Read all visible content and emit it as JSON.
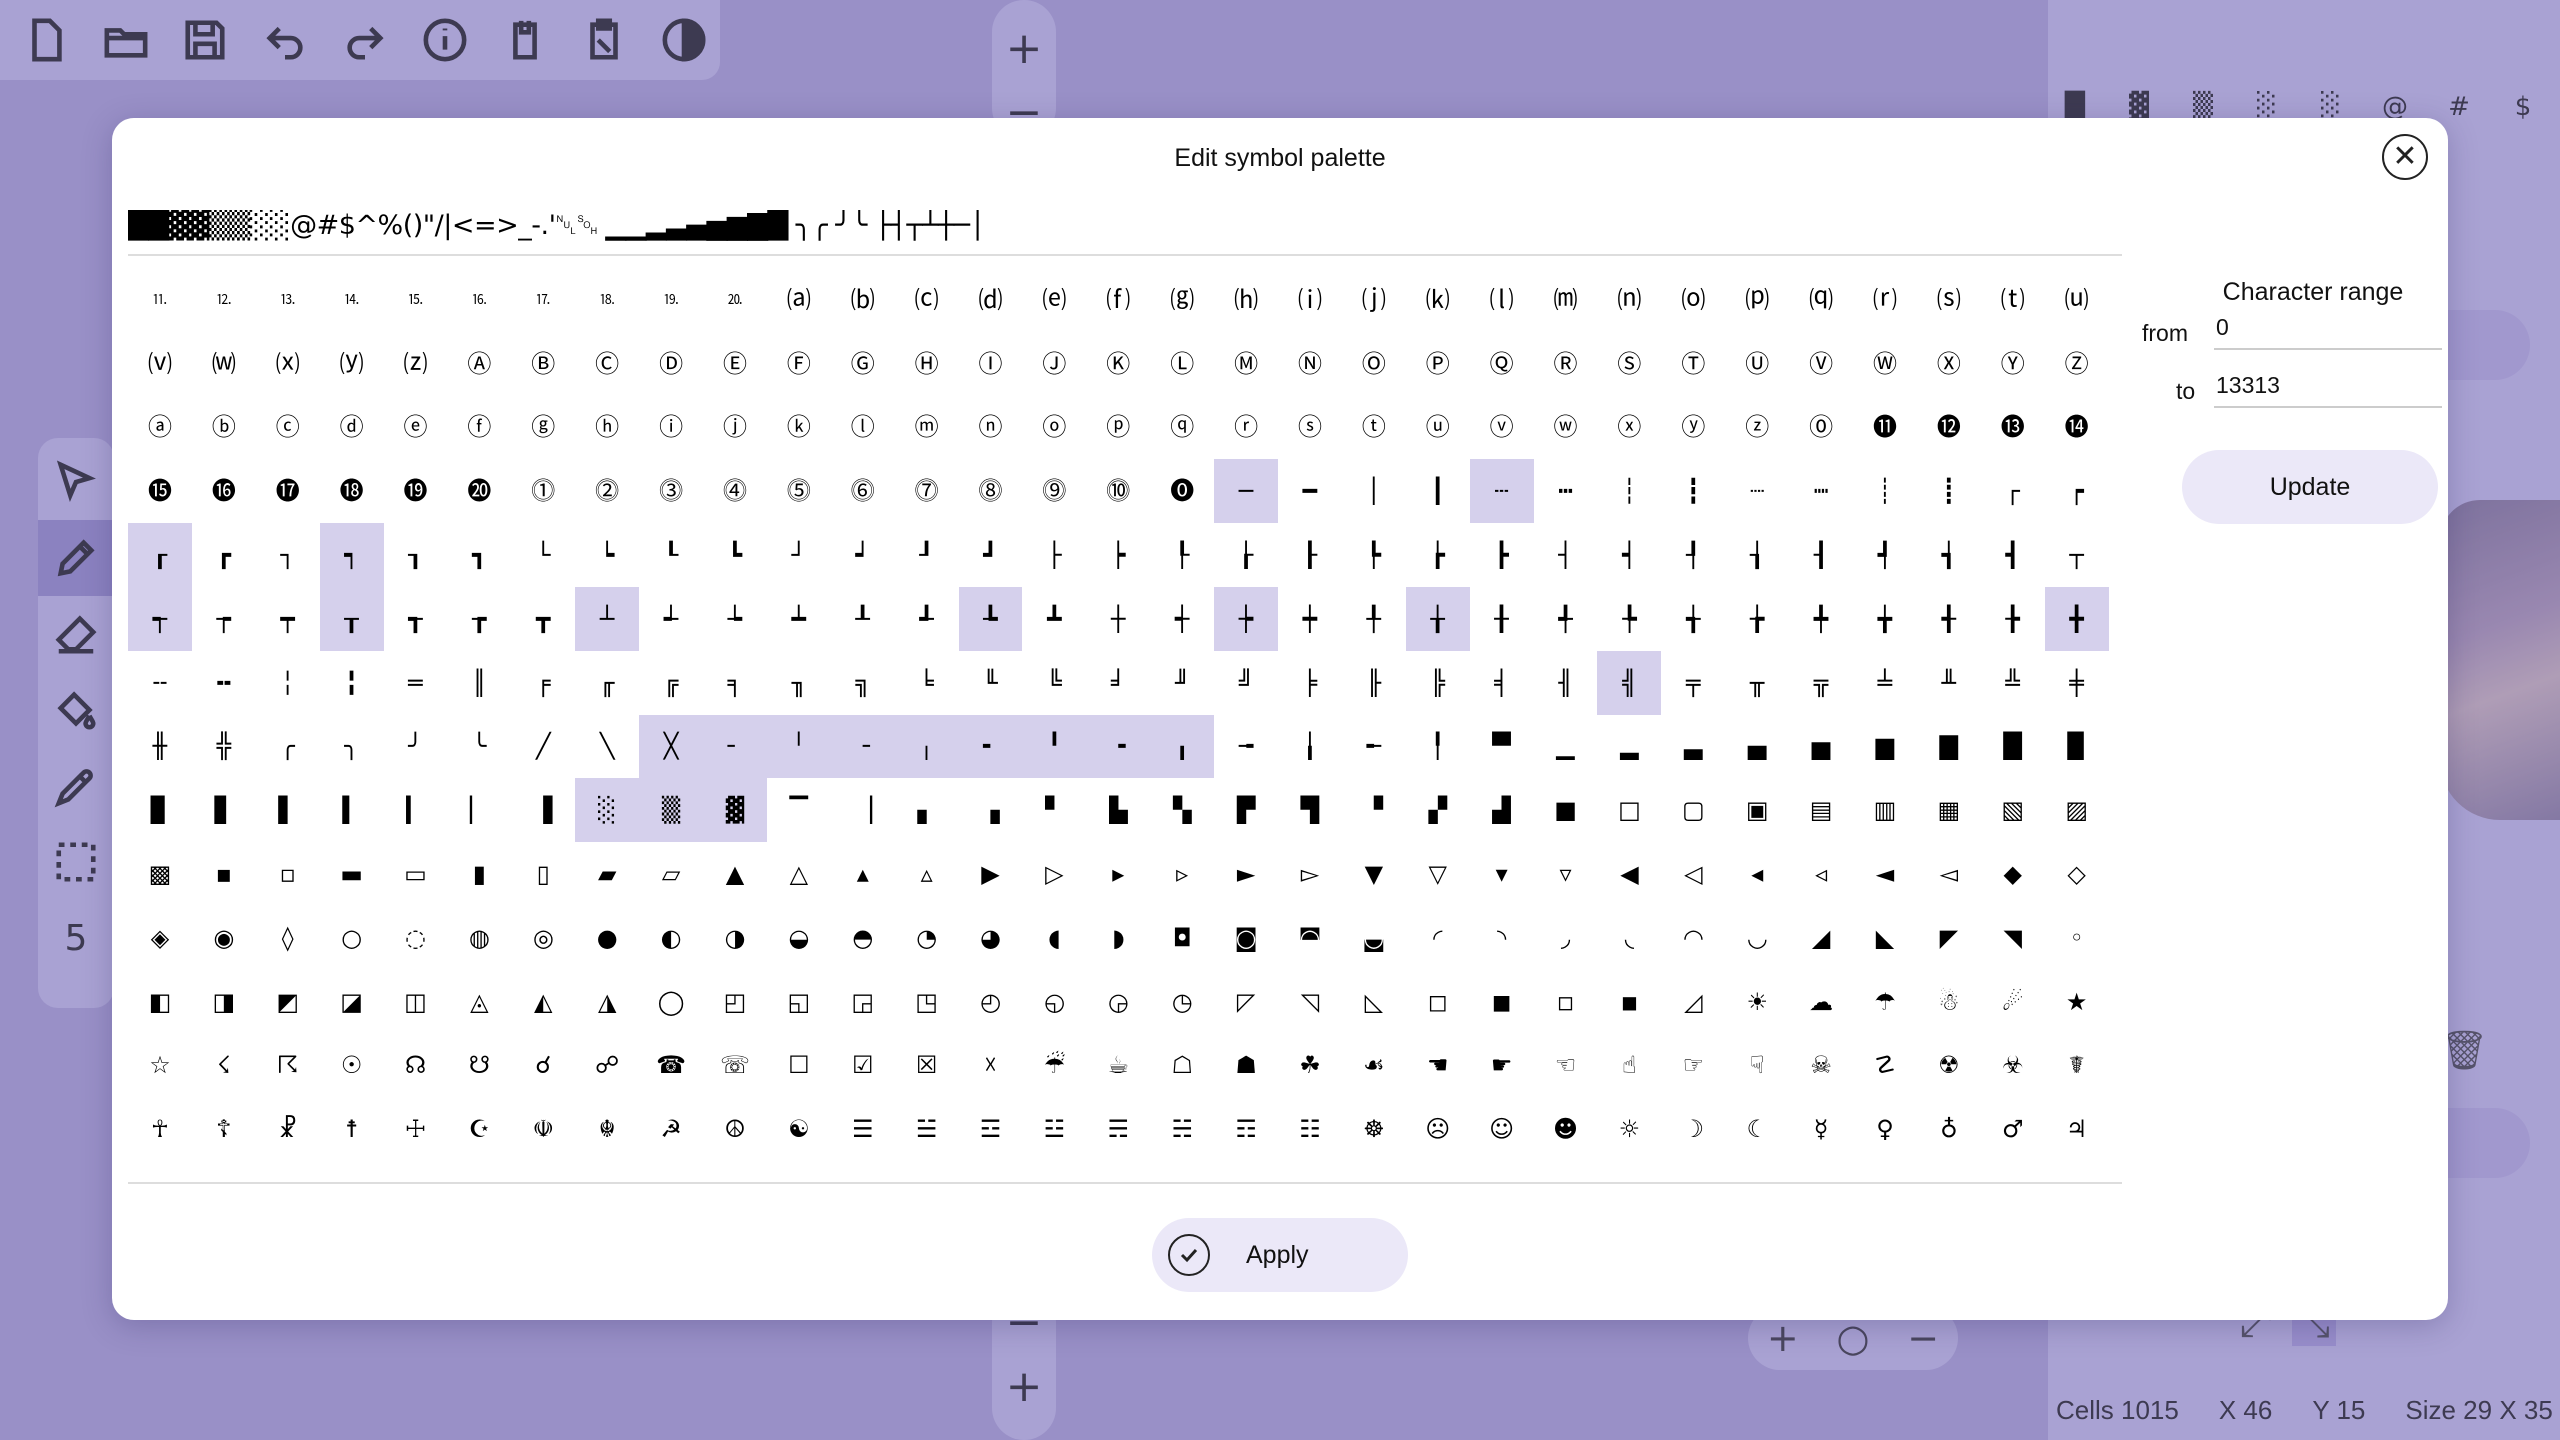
{
  "dialog": {
    "title": "Edit symbol palette",
    "close_glyph": "✕",
    "palette_preview": "██▓▓▒▒░░@#$^%()\"/|<=>_-.'␀␁ ▁▁▂▃▄▅▆▇█ ╮╭ ╯╰ ├┤┬┴┼─│",
    "range": {
      "title": "Character range",
      "from_label": "from",
      "from_value": "0",
      "to_label": "to",
      "to_value": "13313",
      "update_label": "Update"
    },
    "apply_label": "Apply"
  },
  "symbols": [
    "⒒",
    "⒓",
    "⒔",
    "⒕",
    "⒖",
    "⒗",
    "⒘",
    "⒙",
    "⒚",
    "⒛",
    "⒜",
    "⒝",
    "⒞",
    "⒟",
    "⒠",
    "⒡",
    "⒢",
    "⒣",
    "⒤",
    "⒥",
    "⒦",
    "⒧",
    "⒨",
    "⒩",
    "⒪",
    "⒫",
    "⒬",
    "⒭",
    "⒮",
    "⒯",
    "⒰",
    "⒱",
    "⒲",
    "⒳",
    "⒴",
    "⒵",
    "Ⓐ",
    "Ⓑ",
    "Ⓒ",
    "Ⓓ",
    "Ⓔ",
    "Ⓕ",
    "Ⓖ",
    "Ⓗ",
    "Ⓘ",
    "Ⓙ",
    "Ⓚ",
    "Ⓛ",
    "Ⓜ",
    "Ⓝ",
    "Ⓞ",
    "Ⓟ",
    "Ⓠ",
    "Ⓡ",
    "Ⓢ",
    "Ⓣ",
    "Ⓤ",
    "Ⓥ",
    "Ⓦ",
    "Ⓧ",
    "Ⓨ",
    "Ⓩ",
    "ⓐ",
    "ⓑ",
    "ⓒ",
    "ⓓ",
    "ⓔ",
    "ⓕ",
    "ⓖ",
    "ⓗ",
    "ⓘ",
    "ⓙ",
    "ⓚ",
    "ⓛ",
    "ⓜ",
    "ⓝ",
    "ⓞ",
    "ⓟ",
    "ⓠ",
    "ⓡ",
    "ⓢ",
    "ⓣ",
    "ⓤ",
    "ⓥ",
    "ⓦ",
    "ⓧ",
    "ⓨ",
    "ⓩ",
    "⓪",
    "⓫",
    "⓬",
    "⓭",
    "⓮",
    "⓯",
    "⓰",
    "⓱",
    "⓲",
    "⓳",
    "⓴",
    "⓵",
    "⓶",
    "⓷",
    "⓸",
    "⓹",
    "⓺",
    "⓻",
    "⓼",
    "⓽",
    "⓾",
    "⓿",
    "─",
    "━",
    "│",
    "┃",
    "┄",
    "┅",
    "┆",
    "┇",
    "┈",
    "┉",
    "┊",
    "┋",
    "┌",
    "┍",
    "┎",
    "┏",
    "┐",
    "┑",
    "┒",
    "┓",
    "└",
    "┕",
    "┖",
    "┗",
    "┘",
    "┙",
    "┚",
    "┛",
    "├",
    "┝",
    "┞",
    "┟",
    "┠",
    "┡",
    "┢",
    "┣",
    "┤",
    "┥",
    "┦",
    "┧",
    "┨",
    "┩",
    "┪",
    "┫",
    "┬",
    "┭",
    "┮",
    "┯",
    "┰",
    "┱",
    "┲",
    "┳",
    "┴",
    "┵",
    "┶",
    "┷",
    "┸",
    "┹",
    "┺",
    "┻",
    "┼",
    "┽",
    "┾",
    "┿",
    "╀",
    "╁",
    "╂",
    "╃",
    "╄",
    "╅",
    "╆",
    "╇",
    "╈",
    "╉",
    "╊",
    "╋",
    "╌",
    "╍",
    "╎",
    "╏",
    "═",
    "║",
    "╒",
    "╓",
    "╔",
    "╕",
    "╖",
    "╗",
    "╘",
    "╙",
    "╚",
    "╛",
    "╜",
    "╝",
    "╞",
    "╟",
    "╠",
    "╡",
    "╢",
    "╣",
    "╤",
    "╥",
    "╦",
    "╧",
    "╨",
    "╩",
    "╪",
    "╫",
    "╬",
    "╭",
    "╮",
    "╯",
    "╰",
    "╱",
    "╲",
    "╳",
    "╴",
    "╵",
    "╶",
    "╷",
    "╸",
    "╹",
    "╺",
    "╻",
    "╼",
    "╽",
    "╾",
    "╿",
    "▀",
    "▁",
    "▂",
    "▃",
    "▄",
    "▅",
    "▆",
    "▇",
    "█",
    "▉",
    "▊",
    "▋",
    "▌",
    "▍",
    "▎",
    "▏",
    "▐",
    "░",
    "▒",
    "▓",
    "▔",
    "▕",
    "▖",
    "▗",
    "▘",
    "▙",
    "▚",
    "▛",
    "▜",
    "▝",
    "▞",
    "▟",
    "■",
    "□",
    "▢",
    "▣",
    "▤",
    "▥",
    "▦",
    "▧",
    "▨",
    "▩",
    "▪",
    "▫",
    "▬",
    "▭",
    "▮",
    "▯",
    "▰",
    "▱",
    "▲",
    "△",
    "▴",
    "▵",
    "▶",
    "▷",
    "▸",
    "▹",
    "►",
    "▻",
    "▼",
    "▽",
    "▾",
    "▿",
    "◀",
    "◁",
    "◂",
    "◃",
    "◄",
    "◅",
    "◆",
    "◇",
    "◈",
    "◉",
    "◊",
    "○",
    "◌",
    "◍",
    "◎",
    "●",
    "◐",
    "◑",
    "◒",
    "◓",
    "◔",
    "◕",
    "◖",
    "◗",
    "◘",
    "◙",
    "◚",
    "◛",
    "◜",
    "◝",
    "◞",
    "◟",
    "◠",
    "◡",
    "◢",
    "◣",
    "◤",
    "◥",
    "◦",
    "◧",
    "◨",
    "◩",
    "◪",
    "◫",
    "◬",
    "◭",
    "◮",
    "◯",
    "◰",
    "◱",
    "◲",
    "◳",
    "◴",
    "◵",
    "◶",
    "◷",
    "◸",
    "◹",
    "◺",
    "◻",
    "◼",
    "◽",
    "◾",
    "◿",
    "☀",
    "☁",
    "☂",
    "☃",
    "☄",
    "★",
    "☆",
    "☇",
    "☈",
    "☉",
    "☊",
    "☋",
    "☌",
    "☍",
    "☎",
    "☏",
    "☐",
    "☑",
    "☒",
    "☓",
    "☔",
    "☕",
    "☖",
    "☗",
    "☘",
    "☙",
    "☚",
    "☛",
    "☜",
    "☝",
    "☞",
    "☟",
    "☠",
    "☡",
    "☢",
    "☣",
    "☤",
    "☥",
    "☦",
    "☧",
    "☨",
    "☩",
    "☪",
    "☫",
    "☬",
    "☭",
    "☮",
    "☯",
    "☰",
    "☱",
    "☲",
    "☳",
    "☴",
    "☵",
    "☶",
    "☷",
    "☸",
    "☹",
    "☺",
    "☻",
    "☼",
    "☽",
    "☾",
    "☿",
    "♀",
    "♁",
    "♂",
    "♃",
    "♄",
    "♅",
    "♆",
    "♇",
    "♈",
    "♉",
    "♊",
    "♋",
    "♌",
    "♍",
    "♎",
    "♏",
    "♐",
    "♑",
    "♒",
    "♓",
    "♔",
    "♕",
    "♖",
    "♗",
    "♘",
    "♙",
    "♚",
    "♛",
    "♜",
    "♝",
    "♞",
    "♟",
    "♠",
    "♡",
    "♢"
  ],
  "selected_indices": [
    110,
    114,
    124,
    127,
    155,
    158,
    162,
    168,
    172,
    175,
    185,
    209,
    225,
    226,
    227,
    228,
    229,
    230,
    231,
    232,
    233,
    255,
    256,
    257
  ],
  "background": {
    "zoom_in_glyph": "+",
    "zoom_out_glyph": "−",
    "brush_size": "5",
    "right_panel_symbols": [
      "█",
      "▓",
      "▒",
      "░",
      "░",
      "@",
      "#",
      "$"
    ],
    "right_panel_row2": "|   <",
    "shape_buttons": [
      "+",
      "○",
      "−"
    ],
    "status": {
      "cells": "Cells 1015",
      "x": "X 46",
      "y": "Y 15",
      "size": "Size 29 X 35"
    }
  },
  "colors": {
    "accent": "#9f96cc",
    "selected_cell": "#d5d0ec",
    "button_bg": "#ebe8f8",
    "backdrop": "#b2aad6"
  }
}
